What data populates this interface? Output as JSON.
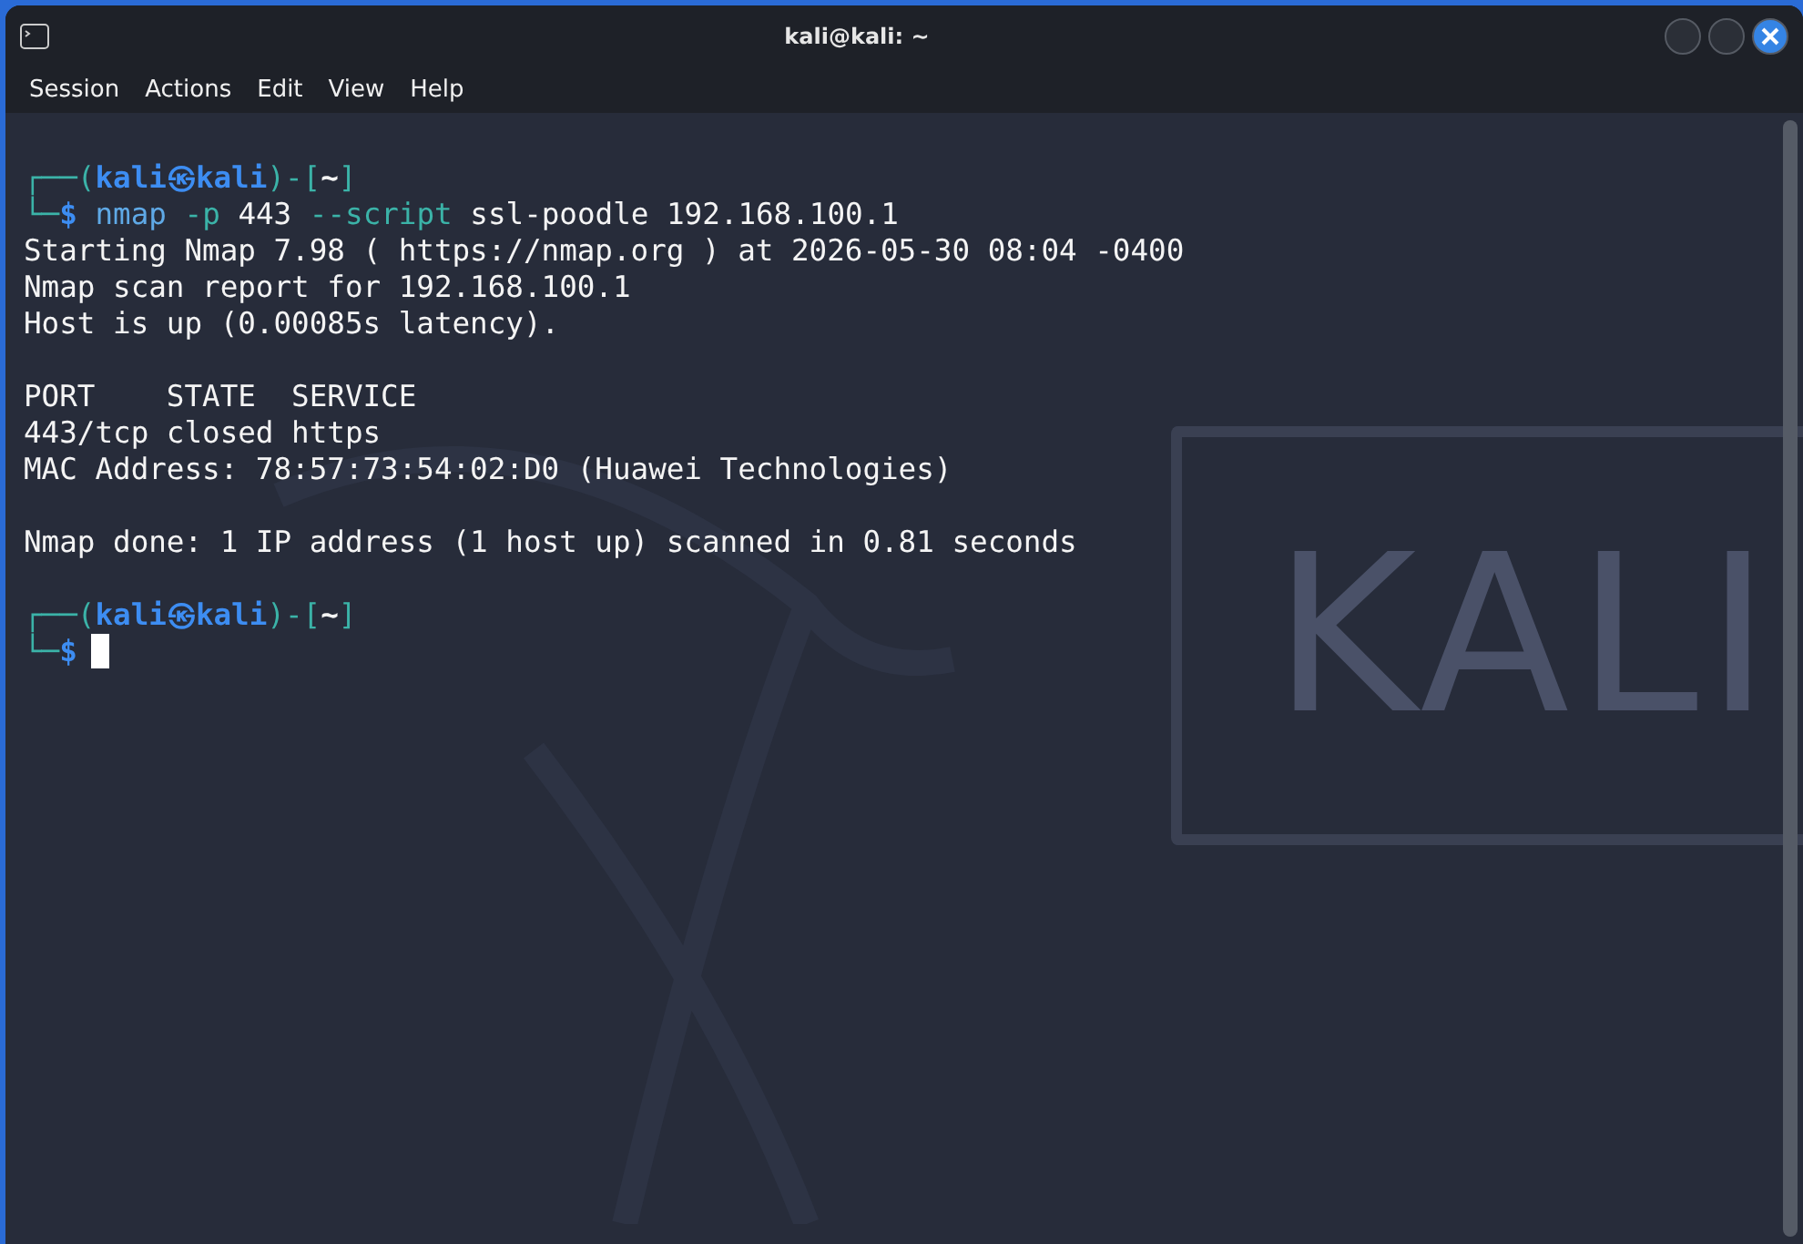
{
  "window": {
    "title": "kali@kali: ~"
  },
  "menu": [
    {
      "label": "Session"
    },
    {
      "label": "Actions"
    },
    {
      "label": "Edit"
    },
    {
      "label": "View"
    },
    {
      "label": "Help"
    }
  ],
  "background_logo": {
    "text": "KALI"
  },
  "lines": [
    {
      "kind": "blank"
    },
    {
      "kind": "prompt",
      "top_corner": "┌──(",
      "user": "kali",
      "at": "㉿",
      "host": "kali",
      "mid": ")-[",
      "dir": "~",
      "close": "]",
      "bottom_corner": "└─",
      "sign": "$",
      "cursor": false,
      "command": [
        {
          "kind": "command",
          "text": "nmap"
        },
        {
          "kind": "option",
          "text": "-p"
        },
        {
          "kind": "argument",
          "text": "443"
        },
        {
          "kind": "option",
          "text": "--script"
        },
        {
          "kind": "argument",
          "text": "ssl-poodle 192.168.100.1"
        }
      ]
    },
    {
      "kind": "output",
      "text": "Starting Nmap 7.98 ( https://nmap.org ) at 2026-05-30 08:04 -0400"
    },
    {
      "kind": "output",
      "text": "Nmap scan report for 192.168.100.1"
    },
    {
      "kind": "output",
      "text": "Host is up (0.00085s latency)."
    },
    {
      "kind": "blank"
    },
    {
      "kind": "output",
      "text": "PORT    STATE  SERVICE"
    },
    {
      "kind": "output",
      "text": "443/tcp closed https"
    },
    {
      "kind": "output",
      "text": "MAC Address: 78:57:73:54:02:D0 (Huawei Technologies)"
    },
    {
      "kind": "blank"
    },
    {
      "kind": "output",
      "text": "Nmap done: 1 IP address (1 host up) scanned in 0.81 seconds"
    },
    {
      "kind": "blank"
    },
    {
      "kind": "prompt",
      "top_corner": "┌──(",
      "user": "kali",
      "at": "㉿",
      "host": "kali",
      "mid": ")-[",
      "dir": "~",
      "close": "]",
      "bottom_corner": "└─",
      "sign": "$",
      "cursor": true
    }
  ]
}
